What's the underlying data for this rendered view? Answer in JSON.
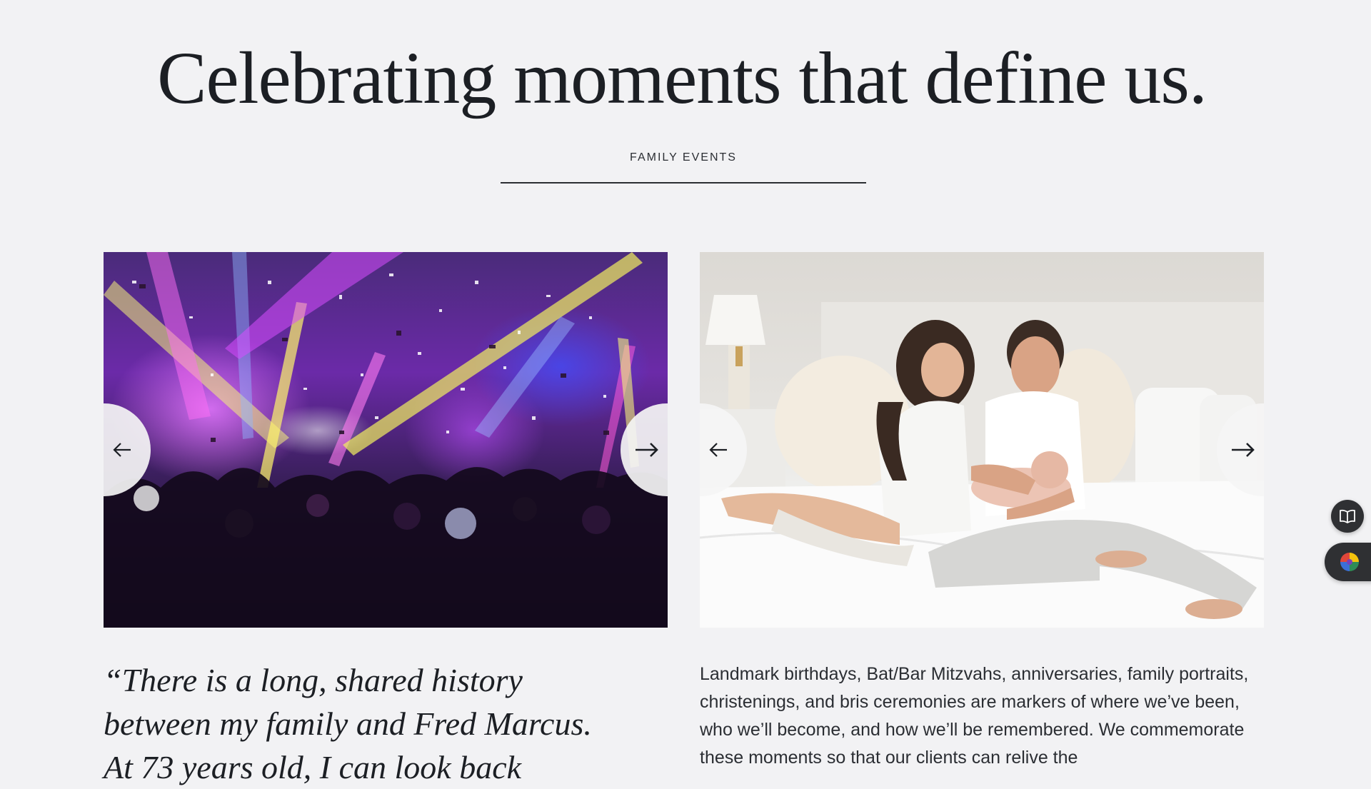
{
  "headline": "Celebrating moments that define us.",
  "eyebrow": "FAMILY EVENTS",
  "carousels": [
    {
      "image_alt": "Party crowd under purple and yellow stage lights with confetti",
      "prev_icon": "arrow-left-icon",
      "next_icon": "arrow-right-icon"
    },
    {
      "image_alt": "Couple holding a newborn baby on a white bed",
      "prev_icon": "arrow-left-icon",
      "next_icon": "arrow-right-icon"
    }
  ],
  "quote": "“There is a long, shared history between my family and Fred Marcus. At 73 years old, I can look back",
  "description": "Landmark birthdays, Bat/Bar Mitzvahs, anniversaries, family portraits, christenings, and bris ceremonies are markers of where we’ve been, who we’ll become, and how we’ll be remembered. We commemorate these moments so that our clients can relive the",
  "floating_buttons": [
    {
      "icon": "book-icon"
    },
    {
      "icon": "color-wheel-icon"
    }
  ],
  "colors": {
    "background": "#f2f2f4",
    "text": "#1c1f24",
    "fab": "#2f3033"
  }
}
